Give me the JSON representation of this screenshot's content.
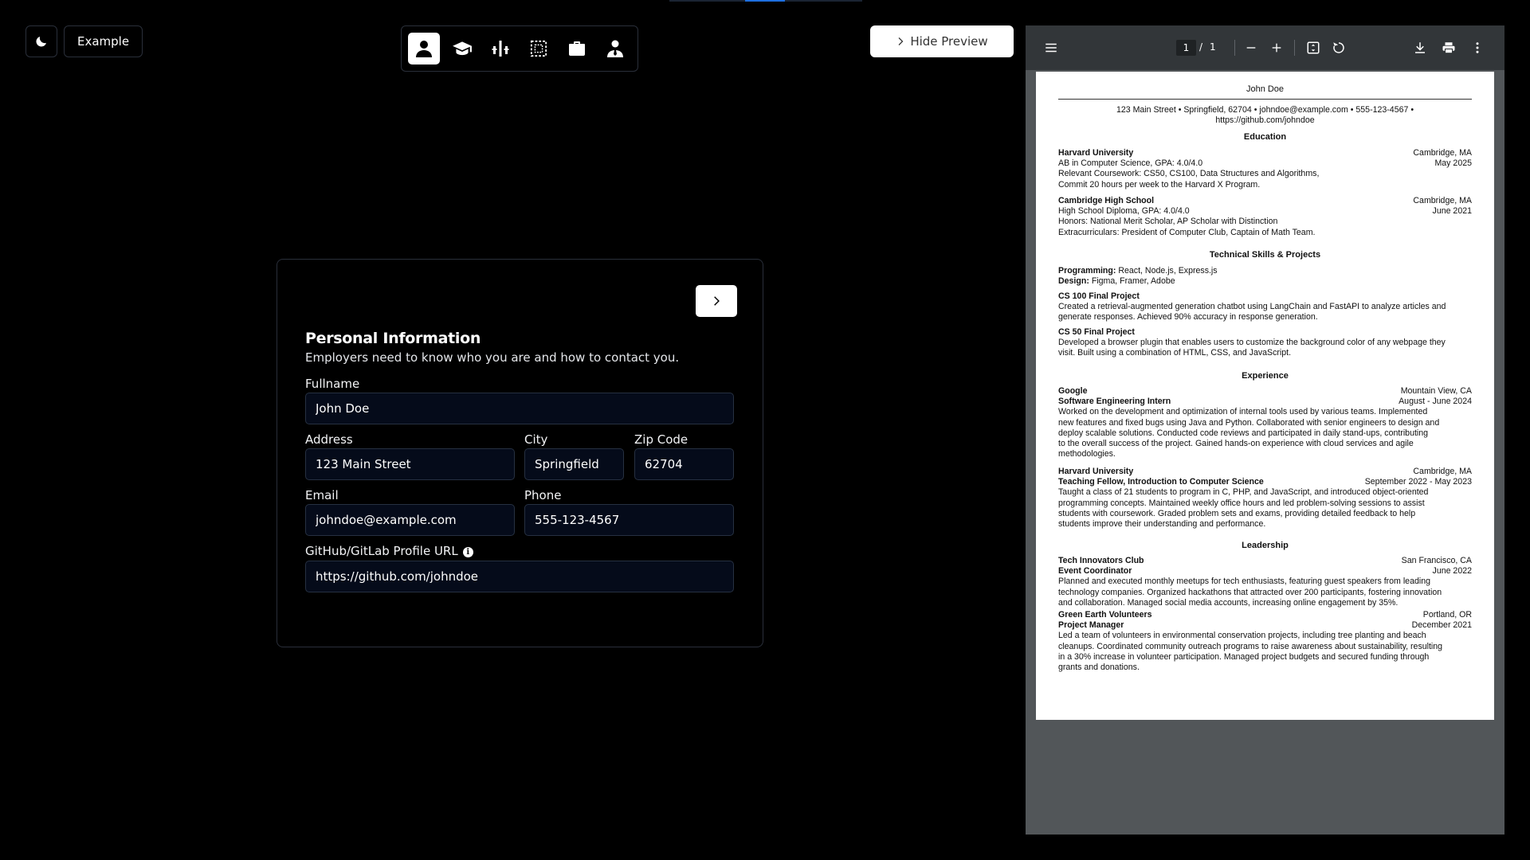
{
  "topbar": {
    "theme_icon": "moon-icon",
    "example_label": "Example",
    "hide_preview_label": "Hide Preview",
    "progress_fraction": 0.2
  },
  "section_nav": {
    "items": [
      {
        "icon": "person-icon",
        "active": true
      },
      {
        "icon": "graduation-cap-icon",
        "active": false
      },
      {
        "icon": "skills-bars-icon",
        "active": false
      },
      {
        "icon": "projects-dashed-box-icon",
        "active": false
      },
      {
        "icon": "briefcase-icon",
        "active": false
      },
      {
        "icon": "leadership-person-tie-icon",
        "active": false
      }
    ]
  },
  "form": {
    "title": "Personal Information",
    "subtitle": "Employers need to know who you are and how to contact you.",
    "fields": {
      "fullname": {
        "label": "Fullname",
        "value": "John Doe"
      },
      "address": {
        "label": "Address",
        "value": "123 Main Street"
      },
      "city": {
        "label": "City",
        "value": "Springfield"
      },
      "zip": {
        "label": "Zip Code",
        "value": "62704"
      },
      "email": {
        "label": "Email",
        "value": "johndoe@example.com"
      },
      "phone": {
        "label": "Phone",
        "value": "555-123-4567"
      },
      "profile_url": {
        "label": "GitHub/GitLab Profile URL",
        "value": "https://github.com/johndoe"
      }
    }
  },
  "viewer": {
    "page_current": "1",
    "page_separator": "/",
    "page_total": "1"
  },
  "resume": {
    "name": "John Doe",
    "contact_line1": "123 Main Street • Springfield, 62704 • johndoe@example.com • 555-123-4567 •",
    "contact_line2": "https://github.com/johndoe",
    "education_title": "Education",
    "edu1": {
      "school": "Harvard University",
      "location": "Cambridge, MA",
      "degree": "AB in Computer Science, GPA: 4.0/4.0",
      "date": "May 2025",
      "line3": "Relevant Coursework: CS50, CS100, Data Structures and Algorithms,",
      "line4": "Commit 20 hours per week to the Harvard X Program."
    },
    "edu2": {
      "school": "Cambridge High School",
      "location": "Cambridge, MA",
      "degree": "High School Diploma, GPA: 4.0/4.0",
      "date": "June 2021",
      "line3": "Honors: National Merit Scholar, AP Scholar with Distinction",
      "line4": "Extracurriculars: President of Computer Club, Captain of Math Team."
    },
    "skills_title": "Technical Skills & Projects",
    "programming_label": "Programming:",
    "programming_value": "React, Node.js, Express.js",
    "design_label": "Design:",
    "design_value": "Figma, Framer, Adobe",
    "proj1": {
      "title": "CS 100 Final Project",
      "line1": "Created a retrieval-augmented generation chatbot using LangChain and FastAPI to analyze articles and",
      "line2": "generate responses. Achieved 90% accuracy in response generation."
    },
    "proj2": {
      "title": "CS 50 Final Project",
      "line1": "Developed a browser plugin that enables users to customize the background color of any webpage they",
      "line2": "visit. Built using a combination of HTML, CSS, and JavaScript."
    },
    "experience_title": "Experience",
    "exp1": {
      "company": "Google",
      "location": "Mountain View, CA",
      "role": "Software Engineering Intern",
      "date": "August - June 2024",
      "lines": [
        "Worked on the development and optimization of internal tools used by various teams. Implemented",
        "new features and fixed bugs using Java and Python. Collaborated with senior engineers to design and",
        "deploy scalable solutions. Conducted code reviews and participated in daily stand-ups, contributing",
        "to the overall success of the project. Gained hands-on experience with cloud services and agile",
        "methodologies."
      ]
    },
    "exp2": {
      "company": "Harvard University",
      "location": "Cambridge, MA",
      "role": "Teaching Fellow, Introduction to Computer Science",
      "date": "September 2022 - May 2023",
      "lines": [
        "Taught a class of 21 students to program in C, PHP, and JavaScript, and introduced object-oriented",
        "programming concepts. Maintained weekly office hours and led problem-solving sessions to assist",
        "students with coursework. Graded problem sets and exams, providing detailed feedback to help",
        "students improve their understanding and performance."
      ]
    },
    "leadership_title": "Leadership",
    "lead1": {
      "org": "Tech Innovators Club",
      "location": "San Francisco, CA",
      "role": "Event Coordinator",
      "date": "June 2022",
      "lines": [
        "Planned and executed monthly meetups for tech enthusiasts, featuring guest speakers from leading",
        "technology companies. Organized hackathons that attracted over 200 participants, fostering innovation",
        "and collaboration. Managed social media accounts, increasing online engagement by 35%."
      ]
    },
    "lead2": {
      "org": "Green Earth Volunteers",
      "location": "Portland, OR",
      "role": "Project Manager",
      "date": "December 2021",
      "lines": [
        "Led a team of volunteers in environmental conservation projects, including tree planting and beach",
        "cleanups. Coordinated community outreach programs to raise awareness about sustainability, resulting",
        "in a 30% increase in volunteer participation. Managed project budgets and secured funding through",
        "grants and donations."
      ]
    }
  }
}
